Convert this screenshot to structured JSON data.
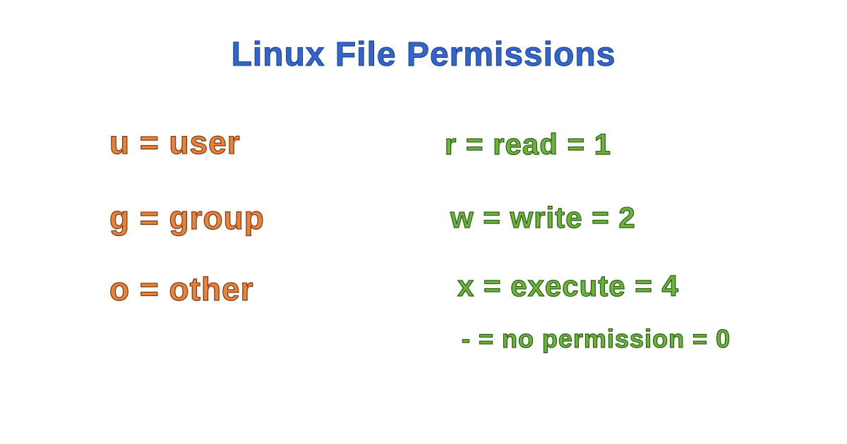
{
  "title": "Linux File Permissions",
  "left": {
    "row1": "u = user",
    "row2": "g = group",
    "row3": "o = other"
  },
  "right": {
    "row1": "r = read = 1",
    "row2": "w = write = 2",
    "row3": "x = execute = 4",
    "row4": "- = no permission = 0"
  }
}
